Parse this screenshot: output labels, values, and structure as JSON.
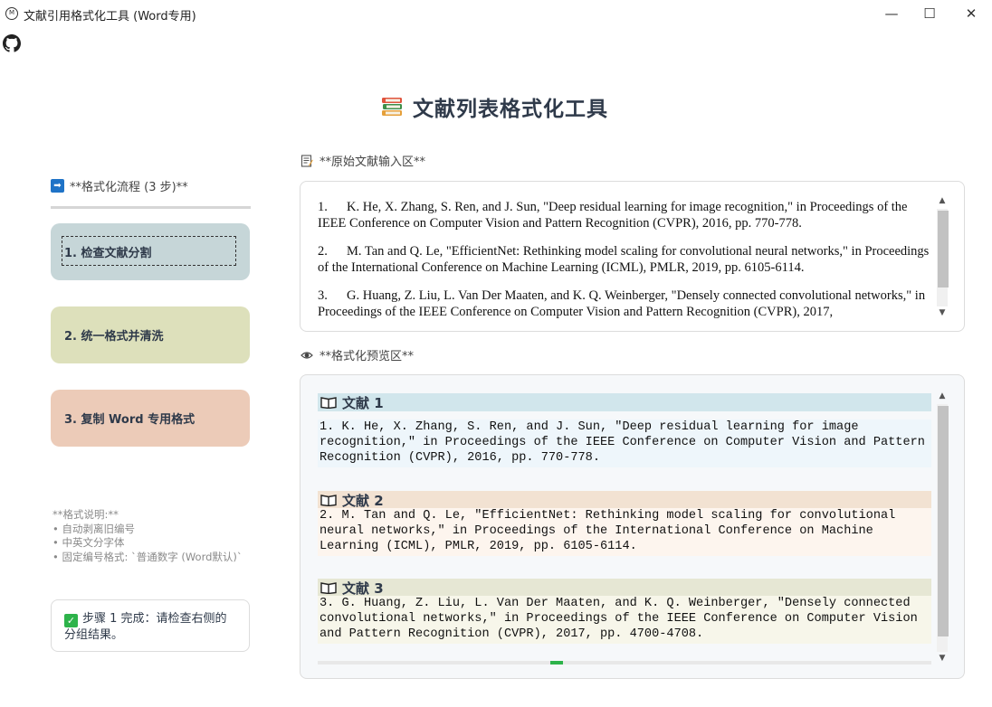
{
  "window": {
    "title": "文献引用格式化工具 (Word专用)",
    "app_icon_text": "M",
    "controls": [
      "—",
      "☐",
      "✕"
    ]
  },
  "page": {
    "title": "文献列表格式化工具"
  },
  "sidebar": {
    "heading": "**格式化流程 (3 步)**",
    "steps": [
      {
        "label": "1. 检查文献分割"
      },
      {
        "label": "2. 统一格式并清洗"
      },
      {
        "label": "3. 复制 Word 专用格式"
      }
    ],
    "notes": {
      "title": "**格式说明:**",
      "items": [
        "• 自动剥离旧编号",
        "• 中英文分字体",
        "• 固定编号格式: `普通数字 (Word默认)`"
      ]
    },
    "status": "步骤 1 完成：请检查右侧的分组结果。"
  },
  "input": {
    "label": "**原始文献输入区**",
    "refs": [
      {
        "num": "1.",
        "text": "K. He, X. Zhang, S. Ren, and J. Sun, \"Deep residual learning for image recognition,\" in Proceedings of the IEEE Conference on Computer Vision and Pattern Recognition (CVPR), 2016, pp. 770-778."
      },
      {
        "num": "2.",
        "text": "M. Tan and Q. Le, \"EfficientNet: Rethinking model scaling for convolutional neural networks,\" in Proceedings of the International Conference on Machine Learning (ICML), PMLR, 2019, pp. 6105-6114."
      },
      {
        "num": "3.",
        "text": "G. Huang, Z. Liu, L. Van Der Maaten, and K. Q. Weinberger, \"Densely connected convolutional networks,\" in Proceedings of the IEEE Conference on Computer Vision and Pattern Recognition (CVPR), 2017,"
      }
    ]
  },
  "preview": {
    "label": "**格式化预览区**",
    "entries": [
      {
        "title": "文献 1",
        "text": "1. K. He, X. Zhang, S. Ren, and J. Sun, \"Deep residual learning for image recognition,\" in Proceedings of the IEEE Conference on Computer Vision and Pattern Recognition (CVPR), 2016, pp. 770-778."
      },
      {
        "title": "文献 2",
        "text": "2. M. Tan and Q. Le, \"EfficientNet: Rethinking model scaling for convolutional neural networks,\" in Proceedings of the International Conference on Machine Learning (ICML), PMLR, 2019, pp. 6105-6114."
      },
      {
        "title": "文献 3",
        "text": "3. G. Huang, Z. Liu, L. Van Der Maaten, and K. Q. Weinberger, \"Densely connected convolutional networks,\" in Proceedings of the IEEE Conference on Computer Vision and Pattern Recognition (CVPR), 2017, pp. 4700-4708."
      }
    ]
  },
  "icons": {
    "arrow": "arrow-right-icon",
    "check": "check-icon",
    "memo": "memo-icon",
    "eye": "eye-icon",
    "book": "open-book-icon",
    "books": "books-icon",
    "github": "github-icon"
  },
  "colors": {
    "step1": "#c6d6d8",
    "step2": "#dde0bb",
    "step3": "#eccbb8",
    "check": "#2db34a",
    "arrow": "#1f73c7"
  }
}
